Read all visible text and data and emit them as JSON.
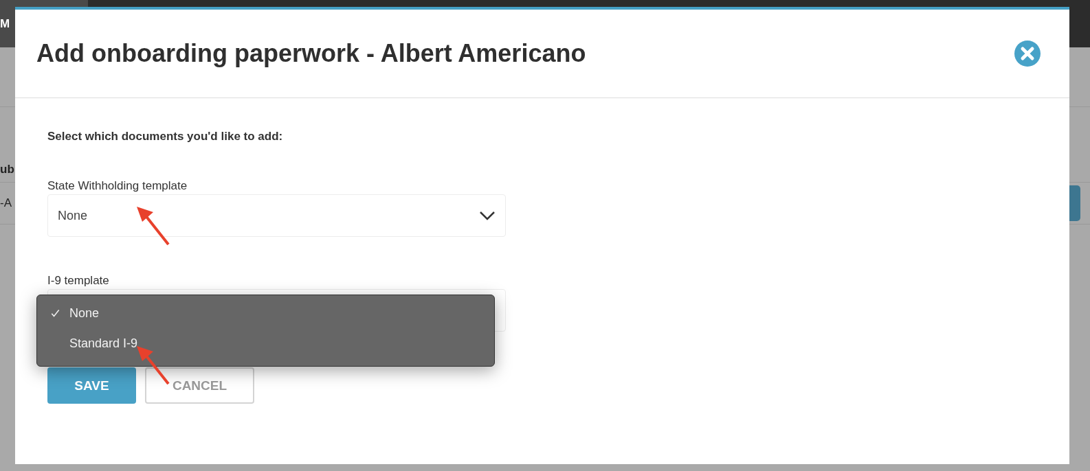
{
  "background": {
    "texts": [
      "M",
      "ub",
      "-A"
    ]
  },
  "dialog": {
    "title": "Add onboarding paperwork - Albert Americano",
    "instruction": "Select which documents you'd like to add:",
    "fields": [
      {
        "label": "State Withholding template",
        "value": "None",
        "open": false
      },
      {
        "label": "I-9 template",
        "open": true,
        "options": [
          {
            "label": "None",
            "selected": true
          },
          {
            "label": "Standard I-9",
            "selected": false
          }
        ]
      }
    ],
    "buttons": [
      {
        "label": "SAVE",
        "kind": "primary"
      },
      {
        "label": "CANCEL",
        "kind": "secondary"
      }
    ]
  }
}
